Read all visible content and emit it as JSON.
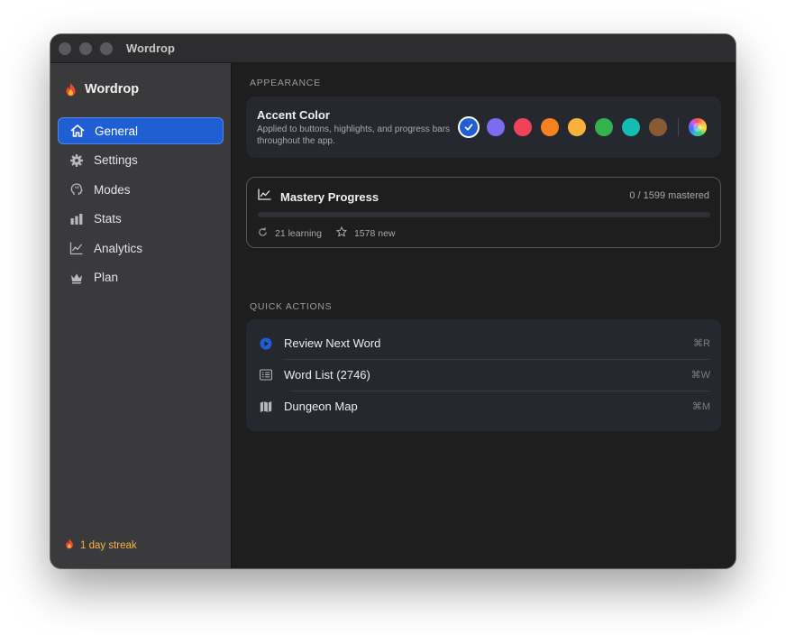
{
  "window": {
    "title": "Wordrop"
  },
  "sidebar": {
    "app_name": "Wordrop",
    "items": [
      {
        "label": "General",
        "icon": "home-icon",
        "active": true
      },
      {
        "label": "Settings",
        "icon": "gear-icon",
        "active": false
      },
      {
        "label": "Modes",
        "icon": "brain-icon",
        "active": false
      },
      {
        "label": "Stats",
        "icon": "bar-chart-icon",
        "active": false
      },
      {
        "label": "Analytics",
        "icon": "line-chart-icon",
        "active": false
      },
      {
        "label": "Plan",
        "icon": "crown-icon",
        "active": false
      }
    ],
    "streak": "1 day streak"
  },
  "appearance": {
    "section_label": "APPEARANCE",
    "accent_title": "Accent Color",
    "accent_desc": "Applied to buttons, highlights, and progress bars throughout the app.",
    "selected_color": "#1f5fd3",
    "swatches": [
      "#1f5fd3",
      "#7b6cf0",
      "#f0435a",
      "#f5821f",
      "#f7b23b",
      "#34b24d",
      "#13bdb2",
      "#8a5a34"
    ]
  },
  "mastery": {
    "title": "Mastery Progress",
    "count": "0 / 1599 mastered",
    "progress": 0,
    "learning": "21 learning",
    "new": "1578 new"
  },
  "quick_actions": {
    "section_label": "QUICK ACTIONS",
    "items": [
      {
        "label": "Review Next Word",
        "shortcut": "⌘R",
        "icon": "play-circle-icon"
      },
      {
        "label": "Word List (2746)",
        "shortcut": "⌘W",
        "icon": "list-icon"
      },
      {
        "label": "Dungeon Map",
        "shortcut": "⌘M",
        "icon": "map-icon"
      }
    ]
  },
  "colors": {
    "accent": "#1f5fd3",
    "streak": "#f5b640",
    "background": "#1e1e1e",
    "sidebar": "#3a3a3c"
  }
}
